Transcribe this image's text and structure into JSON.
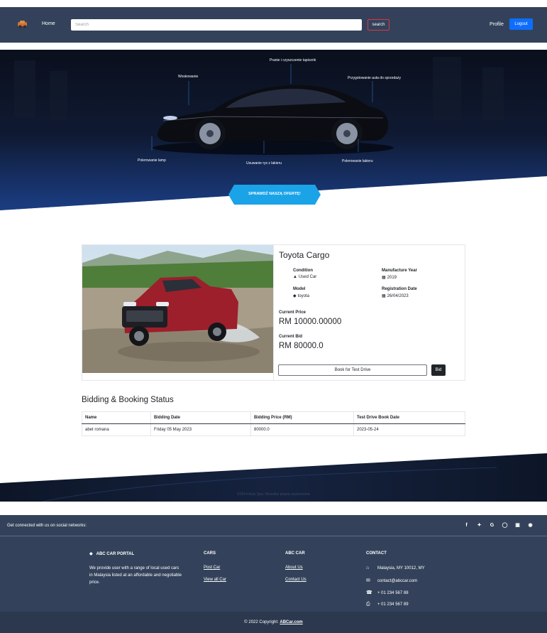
{
  "navbar": {
    "home_label": "Home",
    "search_placeholder": "Search",
    "search_button": "search",
    "profile_label": "Profile",
    "logout_button": "Logout"
  },
  "hero": {
    "labels": {
      "top_center": "Pranie i czyszczenie tapicerki",
      "top_left": "Woskowanie",
      "top_right": "Przygotowanie auta do sprzedaży",
      "bottom_left": "Polerowanie lamp",
      "bottom_center": "Usuwanie rys z lakieru",
      "bottom_right": "Polerowanie lakieru"
    },
    "cta_label": "SPRAWDŹ NASZĄ OFERTĘ!"
  },
  "car": {
    "title": "Toyota Cargo",
    "condition_label": "Condition",
    "condition_value": "Used Car",
    "year_label": "Manufacture Year",
    "year_value": "2019",
    "model_label": "Model",
    "model_value": "toyota",
    "registration_label": "Registration Date",
    "registration_value": "26/04/2023",
    "current_price_label": "Current Price",
    "current_price_value": "RM 10000.00000",
    "current_bid_label": "Current Bid",
    "current_bid_value": "RM 80000.0",
    "test_drive_button": "Book for Test Drive",
    "bid_button": "Bid"
  },
  "status": {
    "title": "Bidding & Booking Status",
    "headers": [
      "Name",
      "Bidding Date",
      "Bidding Price (RM)",
      "Test Drive Book Date"
    ],
    "rows": [
      [
        "abet romana",
        "Friday 05 May 2023",
        "80000.0",
        "2023-05-24"
      ]
    ]
  },
  "band": {
    "text": "©2014 Auto Spa. Wszelkie prawa zastrzeżone"
  },
  "social": {
    "text": "Get connected with us on social networks:",
    "icons": [
      "facebook-icon",
      "twitter-icon",
      "google-icon",
      "instagram-icon",
      "linkedin-icon",
      "github-icon"
    ]
  },
  "footer": {
    "portal_title": "ABC CAR PORTAL",
    "portal_text": "We provide user with a range of local used cars in Malaysia listed at an affordable and negotiable price.",
    "cars_title": "CARS",
    "cars_links": [
      "Post Car",
      "View all Car"
    ],
    "abc_title": "ABC CAR",
    "abc_links": [
      "About Us",
      "Contact Us"
    ],
    "contact_title": "CONTACT",
    "contact_address": "Malaysia, MY 10012, MY",
    "contact_email": "contact@abccar.com",
    "contact_phone": "+ 01 234 567 88",
    "contact_fax": "+ 01 234 567 89",
    "copyright_prefix": "© 2022 Copyright:",
    "copyright_link": "ABCar.com"
  },
  "colors": {
    "navbar_bg": "#33425a",
    "logout_bg": "#0d6efd",
    "search_border": "#dc3545",
    "cta_bg": "#1ba3e8"
  }
}
